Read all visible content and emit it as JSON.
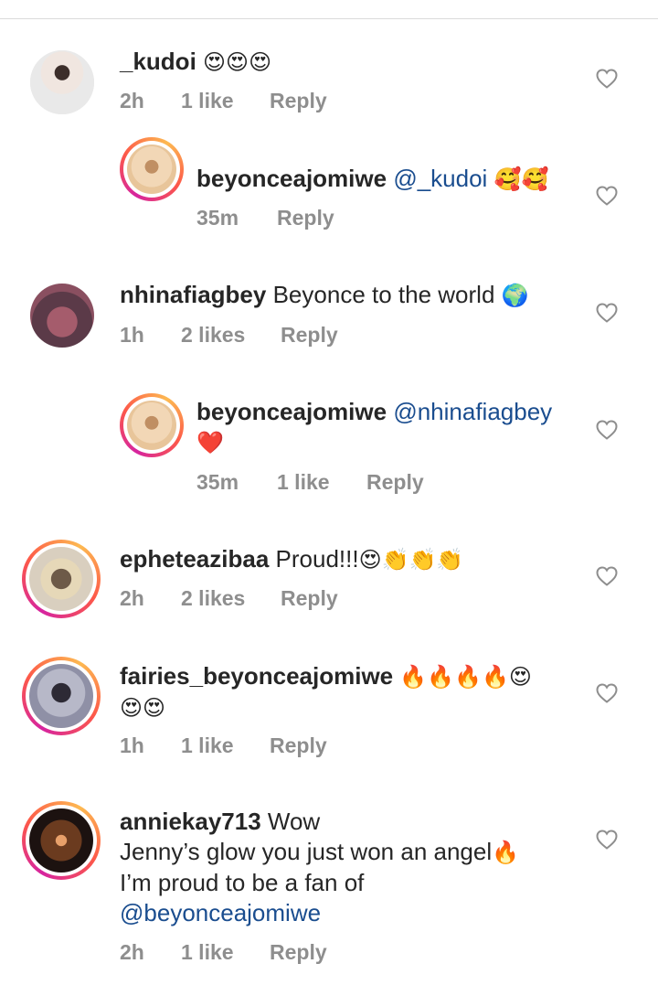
{
  "comments": [
    {
      "username": "_kudoi",
      "text": "",
      "emoji": "😍😍😍",
      "time": "2h",
      "likes": "1 like",
      "reply": "Reply",
      "avatar_colors": [
        "#e9e9e9",
        "#3c2e2a"
      ]
    },
    {
      "username": "beyonceajomiwe",
      "mention": "@_kudoi",
      "emoji": "🥰🥰",
      "time": "35m",
      "reply": "Reply",
      "avatar_colors": [
        "#f2d7b6",
        "#c08f63"
      ]
    },
    {
      "username": "nhinafiagbey",
      "text": "Beyonce to the world",
      "emoji": "🌍",
      "time": "1h",
      "likes": "2 likes",
      "reply": "Reply",
      "avatar_colors": [
        "#a55c6c",
        "#5b3a48"
      ]
    },
    {
      "username": "beyonceajomiwe",
      "mention": "@nhinafiagbey",
      "emoji": "❤️",
      "time": "35m",
      "likes": "1 like",
      "reply": "Reply",
      "avatar_colors": [
        "#f2d7b6",
        "#c08f63"
      ]
    },
    {
      "username": "epheteazibaa",
      "text": "Proud!!!",
      "emoji": "😍👏👏👏",
      "time": "2h",
      "likes": "2 likes",
      "reply": "Reply",
      "avatar_colors": [
        "#d9cfbf",
        "#6d5a48"
      ]
    },
    {
      "username": "fairies_beyonceajomiwe",
      "emoji": "🔥🔥🔥🔥😍",
      "emoji2": "😍😍",
      "time": "1h",
      "likes": "1 like",
      "reply": "Reply",
      "avatar_colors": [
        "#b7b8c8",
        "#2d2a35"
      ]
    },
    {
      "username": "anniekay713",
      "text": "Wow",
      "line2": "Jenny’s glow you just won an angel",
      "emoji": "🔥",
      "line3": "I’m proud to be a fan of",
      "mention": "@beyonceajomiwe",
      "time": "2h",
      "likes": "1 like",
      "reply": "Reply",
      "avatar_colors": [
        "#6b3b1f",
        "#1c1210"
      ]
    }
  ],
  "heart_icon_color": "#8e8e8e",
  "mention_color": "#1a4d8f",
  "ring_colors": [
    "#d6249f",
    "#fd5949",
    "#fdb951"
  ]
}
